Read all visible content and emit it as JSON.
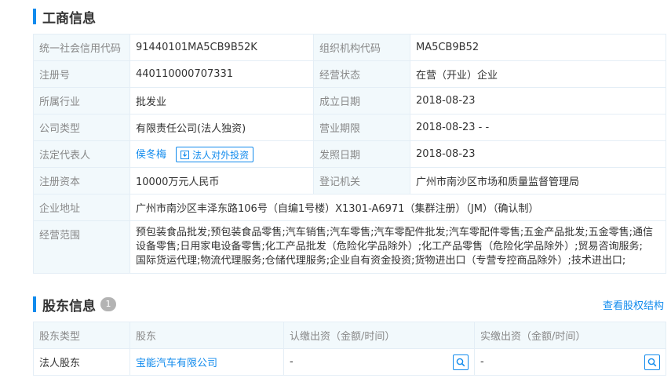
{
  "business": {
    "title": "工商信息",
    "rows": [
      {
        "l1": "统一社会信用代码",
        "v1": "91440101MA5CB9B52K",
        "l2": "组织机构代码",
        "v2": "MA5CB9B52"
      },
      {
        "l1": "注册号",
        "v1": "440110000707331",
        "l2": "经营状态",
        "v2": "在营（开业）企业"
      },
      {
        "l1": "所属行业",
        "v1": "批发业",
        "l2": "成立日期",
        "v2": "2018-08-23"
      },
      {
        "l1": "公司类型",
        "v1": "有限责任公司(法人独资)",
        "l2": "营业期限",
        "v2": "2018-08-23 - -"
      },
      {
        "l1": "法定代表人",
        "v1": "侯冬梅",
        "btn": "法人对外投资",
        "l2": "发照日期",
        "v2": "2018-08-23"
      },
      {
        "l1": "注册资本",
        "v1": "10000万元人民币",
        "l2": "登记机关",
        "v2": "广州市南沙区市场和质量监督管理局"
      }
    ],
    "address_label": "企业地址",
    "address": "广州市南沙区丰泽东路106号（自编1号楼）X1301-A6971（集群注册）（JM）（确认制）",
    "scope_label": "经营范围",
    "scope_lines": [
      "预包装食品批发;预包装食品零售;汽车销售;汽车零售;汽车零配件批发;汽车零配件零售;五金产品批发;五金零售;通信",
      "设备零售;日用家电设备零售;化工产品批发（危险化学品除外）;化工产品零售（危险化学品除外）;贸易咨询服务;",
      "国际货运代理;物流代理服务;仓储代理服务;企业自有资金投资;货物进出口（专营专控商品除外）;技术进出口;"
    ]
  },
  "shareholders": {
    "title": "股东信息",
    "count": "1",
    "link": "查看股权结构",
    "headers": [
      "股东类型",
      "股东",
      "认缴出资（金额/时间）",
      "实缴出资（金额/时间）"
    ],
    "rows": [
      {
        "type": "法人股东",
        "name": "宝能汽车有限公司",
        "subscribed": "-",
        "paid": "-"
      }
    ]
  },
  "colors": {
    "accent": "#128bed",
    "label_bg": "#f2f9fc",
    "border": "#e4eef6"
  },
  "icons": [
    "download-icon",
    "search-icon"
  ]
}
